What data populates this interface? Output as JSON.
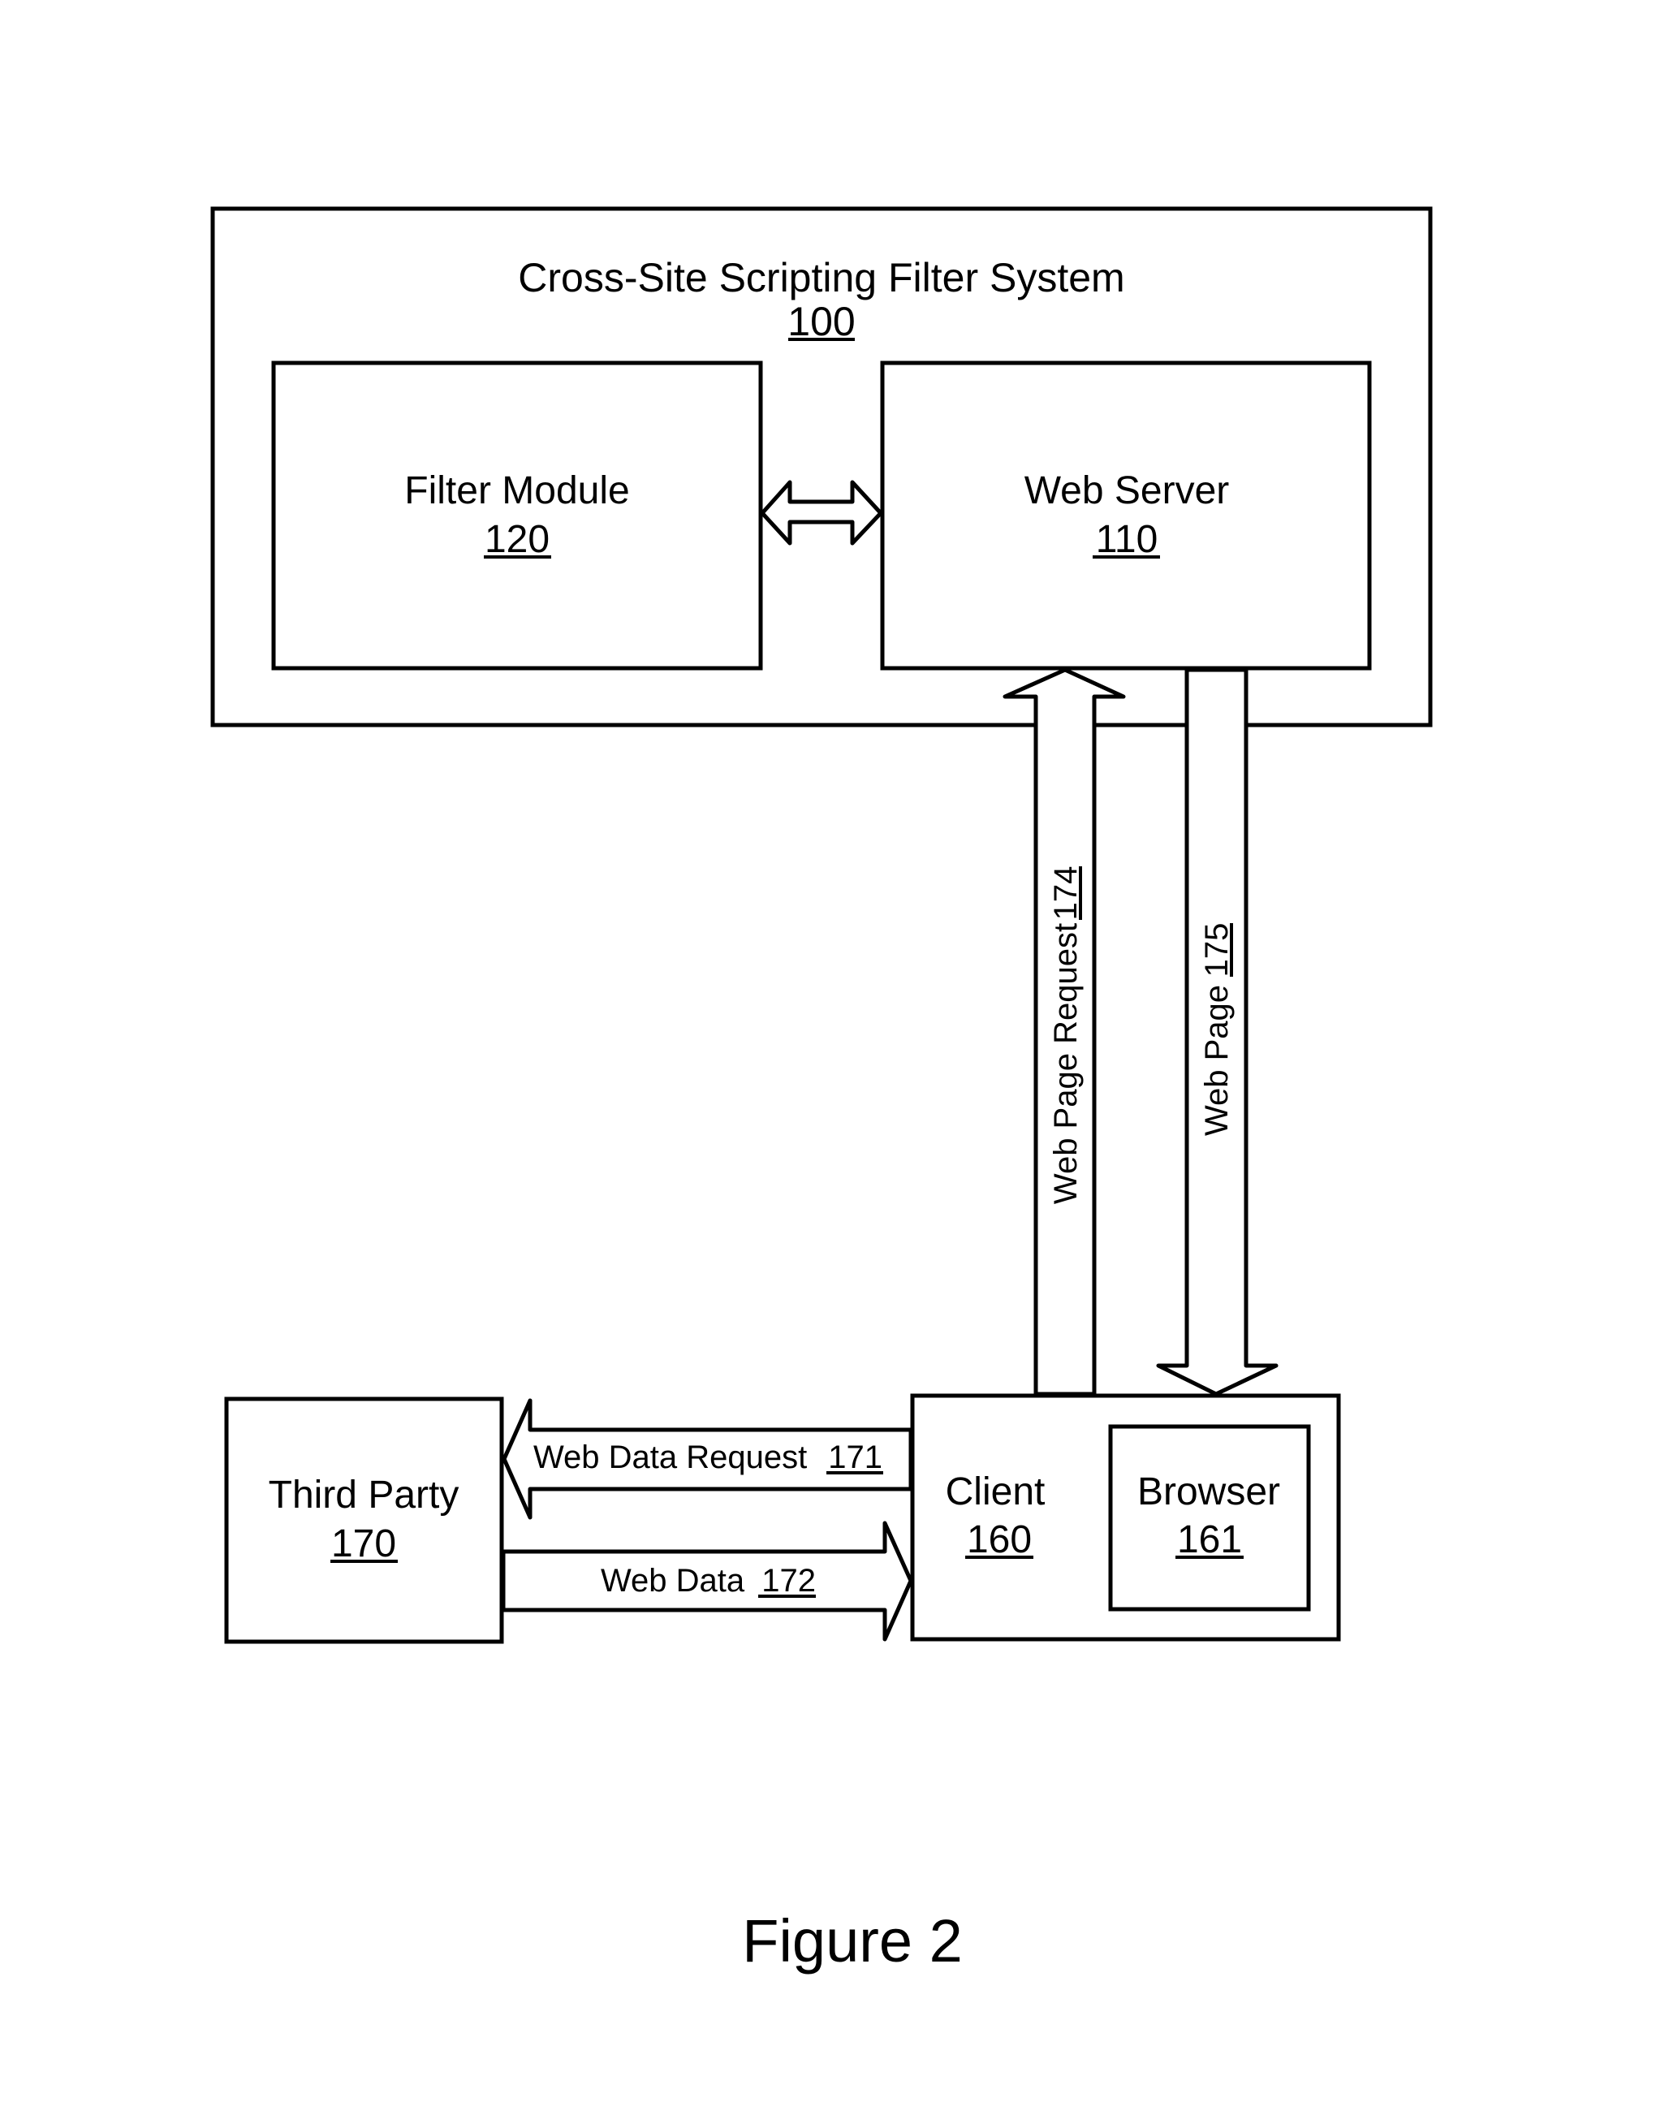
{
  "figure_caption": "Figure 2",
  "system": {
    "title": "Cross-Site Scripting Filter System",
    "ref": "100"
  },
  "components": {
    "filter_module": {
      "label": "Filter Module",
      "ref": "120"
    },
    "web_server": {
      "label": "Web Server",
      "ref": "110"
    },
    "client": {
      "label": "Client",
      "ref": "160"
    },
    "browser": {
      "label": "Browser",
      "ref": "161"
    },
    "third_party": {
      "label": "Third Party",
      "ref": "170"
    }
  },
  "connections": {
    "filter_web_server": {
      "type": "bidirectional",
      "from": "Filter Module",
      "to": "Web Server"
    },
    "web_page_request": {
      "label": "Web Page Request",
      "ref": "174",
      "from": "Client",
      "to": "Web Server"
    },
    "web_page": {
      "label": "Web Page",
      "ref": "175",
      "from": "Web Server",
      "to": "Client"
    },
    "web_data_request": {
      "label": "Web Data Request",
      "ref": "171",
      "from": "Client",
      "to": "Third Party"
    },
    "web_data": {
      "label": "Web Data",
      "ref": "172",
      "from": "Third Party",
      "to": "Client"
    }
  }
}
